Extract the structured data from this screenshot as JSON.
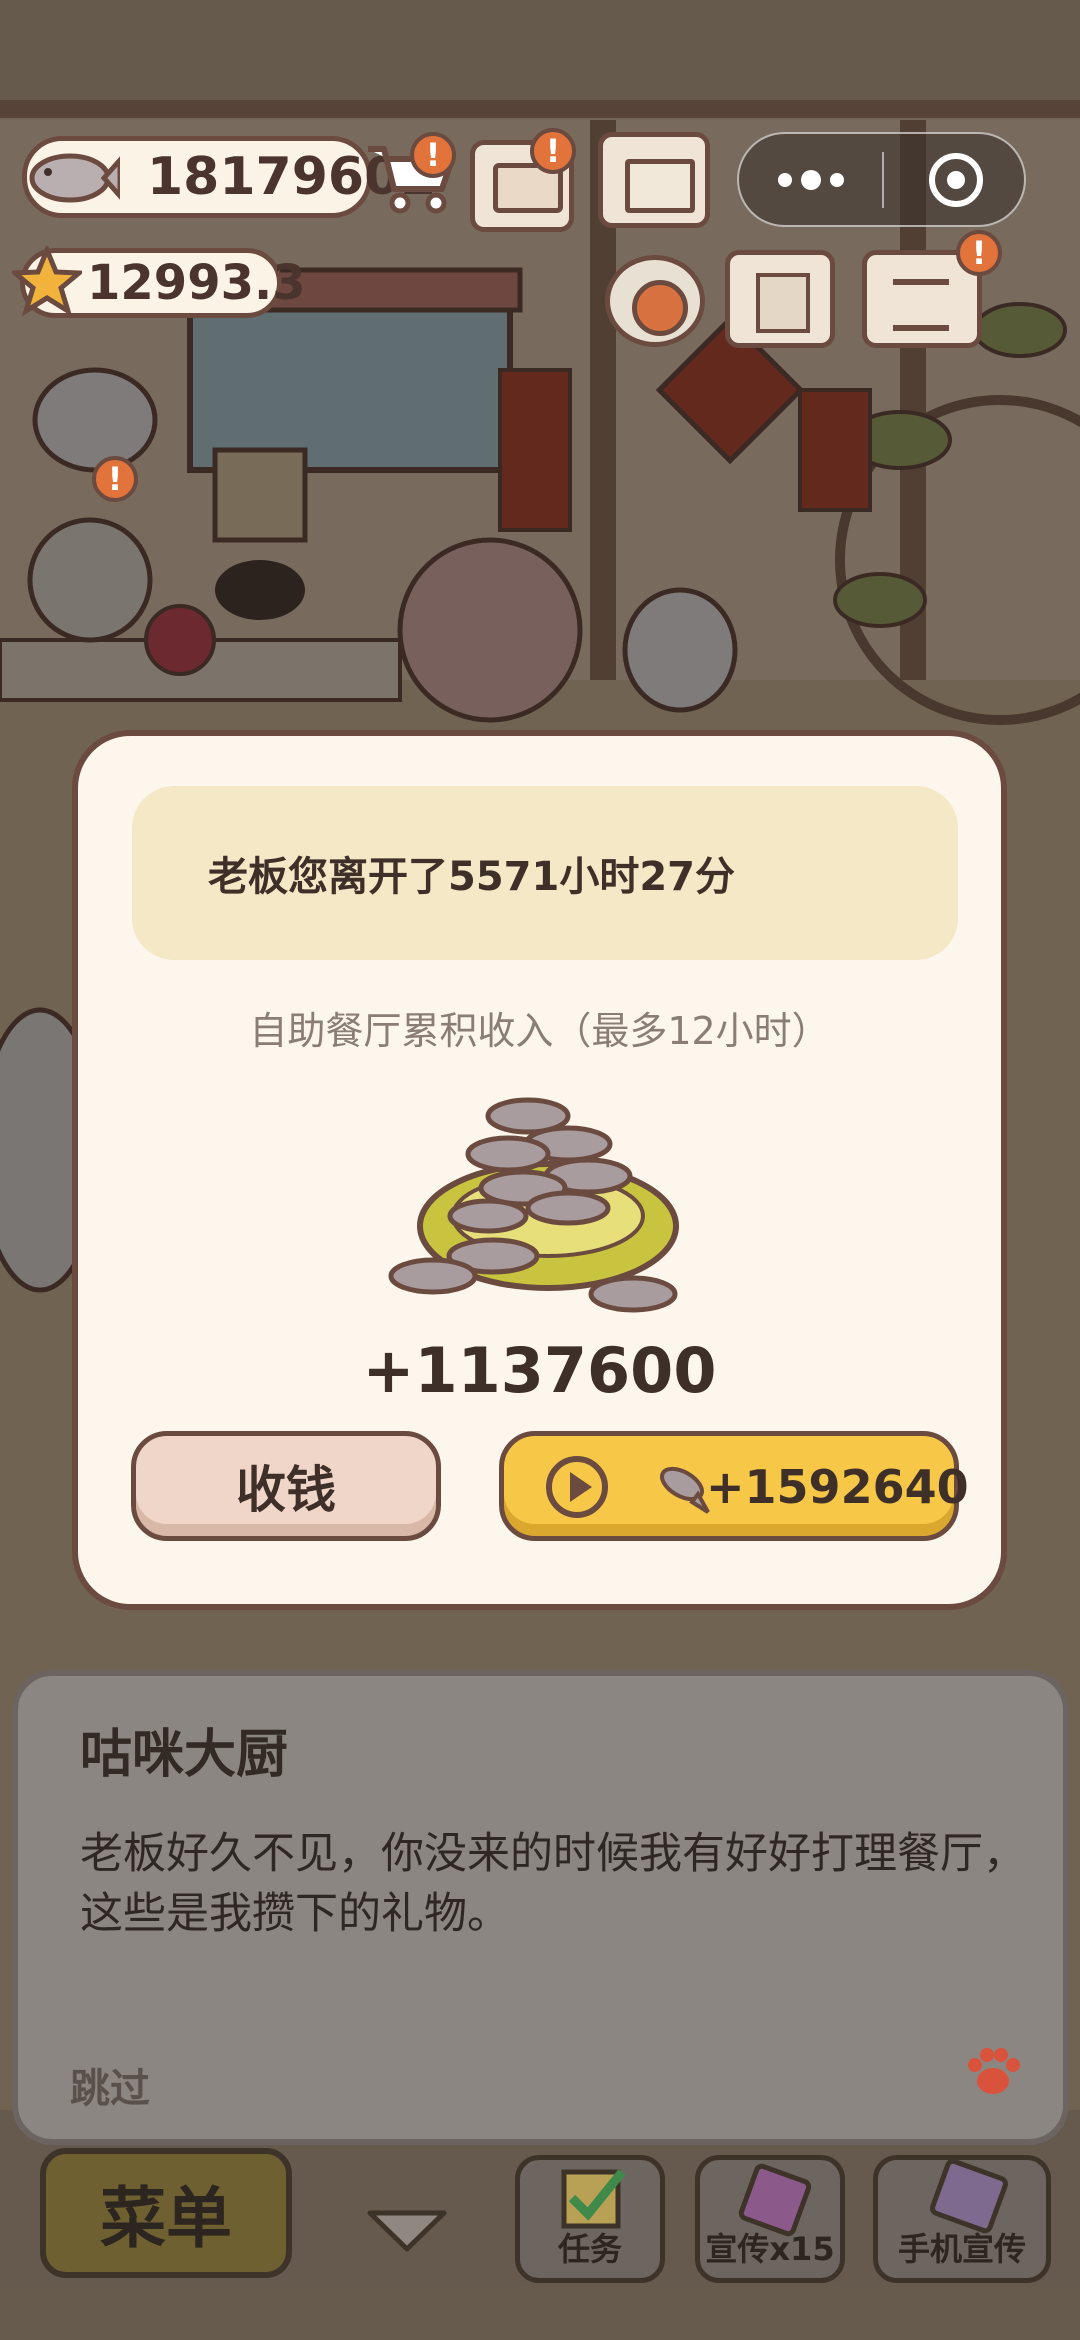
{
  "hud": {
    "fish_coins": "18179602",
    "stars": "12993.3",
    "alert_badge": "!"
  },
  "modal": {
    "away_message": "老板您离开了5571小时27分",
    "accumulated_label": "自助餐厅累积收入（最多12小时）",
    "reward_amount": "+1137600",
    "collect_label": "收钱",
    "ad_reward_amount": "+1592640"
  },
  "dialogue": {
    "speaker": "咕咪大厨",
    "text": "老板好久不见，你没来的时候我有好好打理餐厅，这些是我攒下的礼物。",
    "skip_label": "跳过"
  },
  "bottom_bar": {
    "menu_label": "菜单",
    "tasks_label": "任务",
    "promo_label": "宣传x15",
    "phone_promo_label": "手机宣传"
  },
  "colors": {
    "outline": "#6b4a3f",
    "panel": "#fdf6ec",
    "ad_button": "#f7c847",
    "collect_button": "#f0d6c9",
    "badge": "#e2733b"
  }
}
